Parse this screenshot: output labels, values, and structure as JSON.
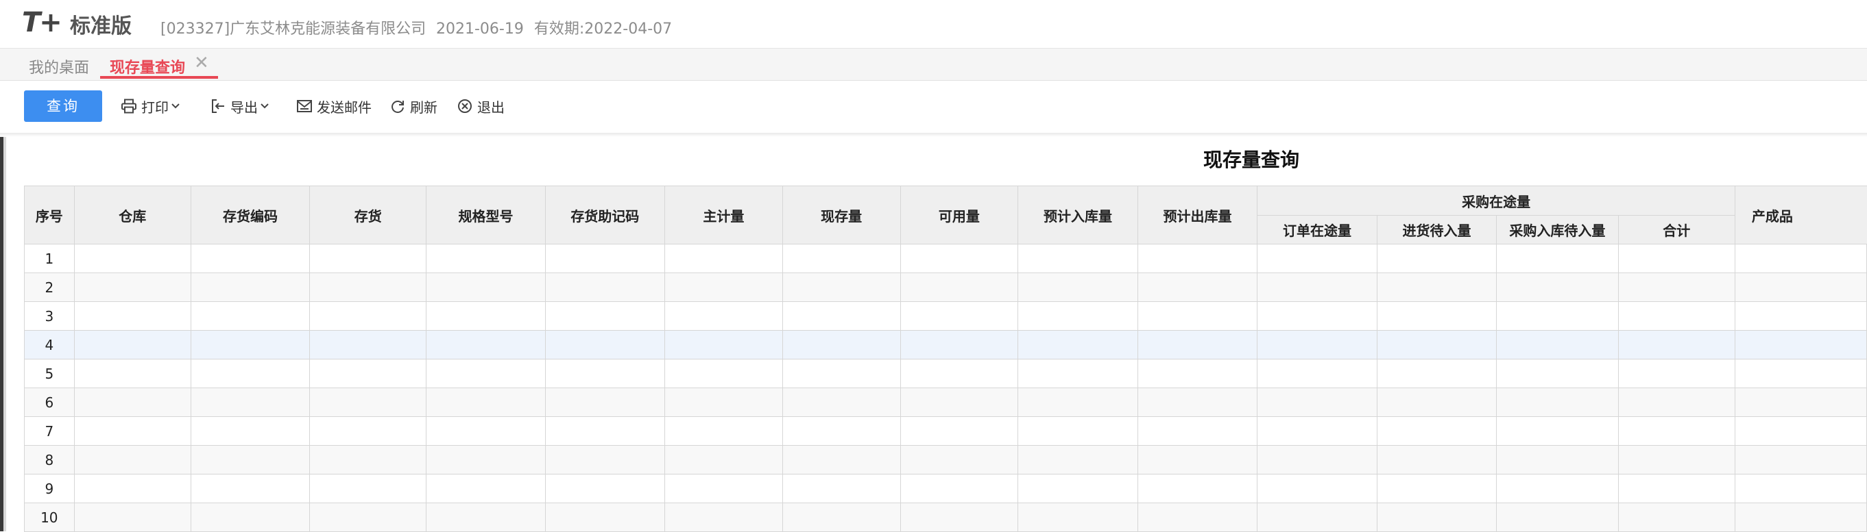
{
  "header": {
    "logo": "T+",
    "edition": "标准版",
    "company": "[023327]广东艾林克能源装备有限公司",
    "date": "2021-06-19",
    "validity": "有效期:2022-04-07"
  },
  "tabs": [
    {
      "label": "我的桌面"
    },
    {
      "label": "现存量查询",
      "active": true,
      "close": "✕"
    }
  ],
  "toolbar": {
    "query": "查询",
    "print": "打印",
    "export": "导出",
    "mail": "发送邮件",
    "refresh": "刷新",
    "exit": "退出"
  },
  "report": {
    "title": "现存量查询",
    "columns": [
      "序号",
      "仓库",
      "存货编码",
      "存货",
      "规格型号",
      "存货助记码",
      "主计量",
      "现存量",
      "可用量",
      "预计入库量",
      "预计出库量"
    ],
    "group": {
      "label": "采购在途量",
      "sub": [
        "订单在途量",
        "进货待入量",
        "采购入库待入量",
        "合计"
      ]
    },
    "last_column": "产成品"
  },
  "rows": [
    "1",
    "2",
    "3",
    "4",
    "5",
    "6",
    "7",
    "8",
    "9",
    "10"
  ],
  "colors": {
    "accent": "#3d8ef0",
    "active_tab": "#e84855",
    "header_bg": "#efefef",
    "selected_row": "#eef4fc"
  }
}
